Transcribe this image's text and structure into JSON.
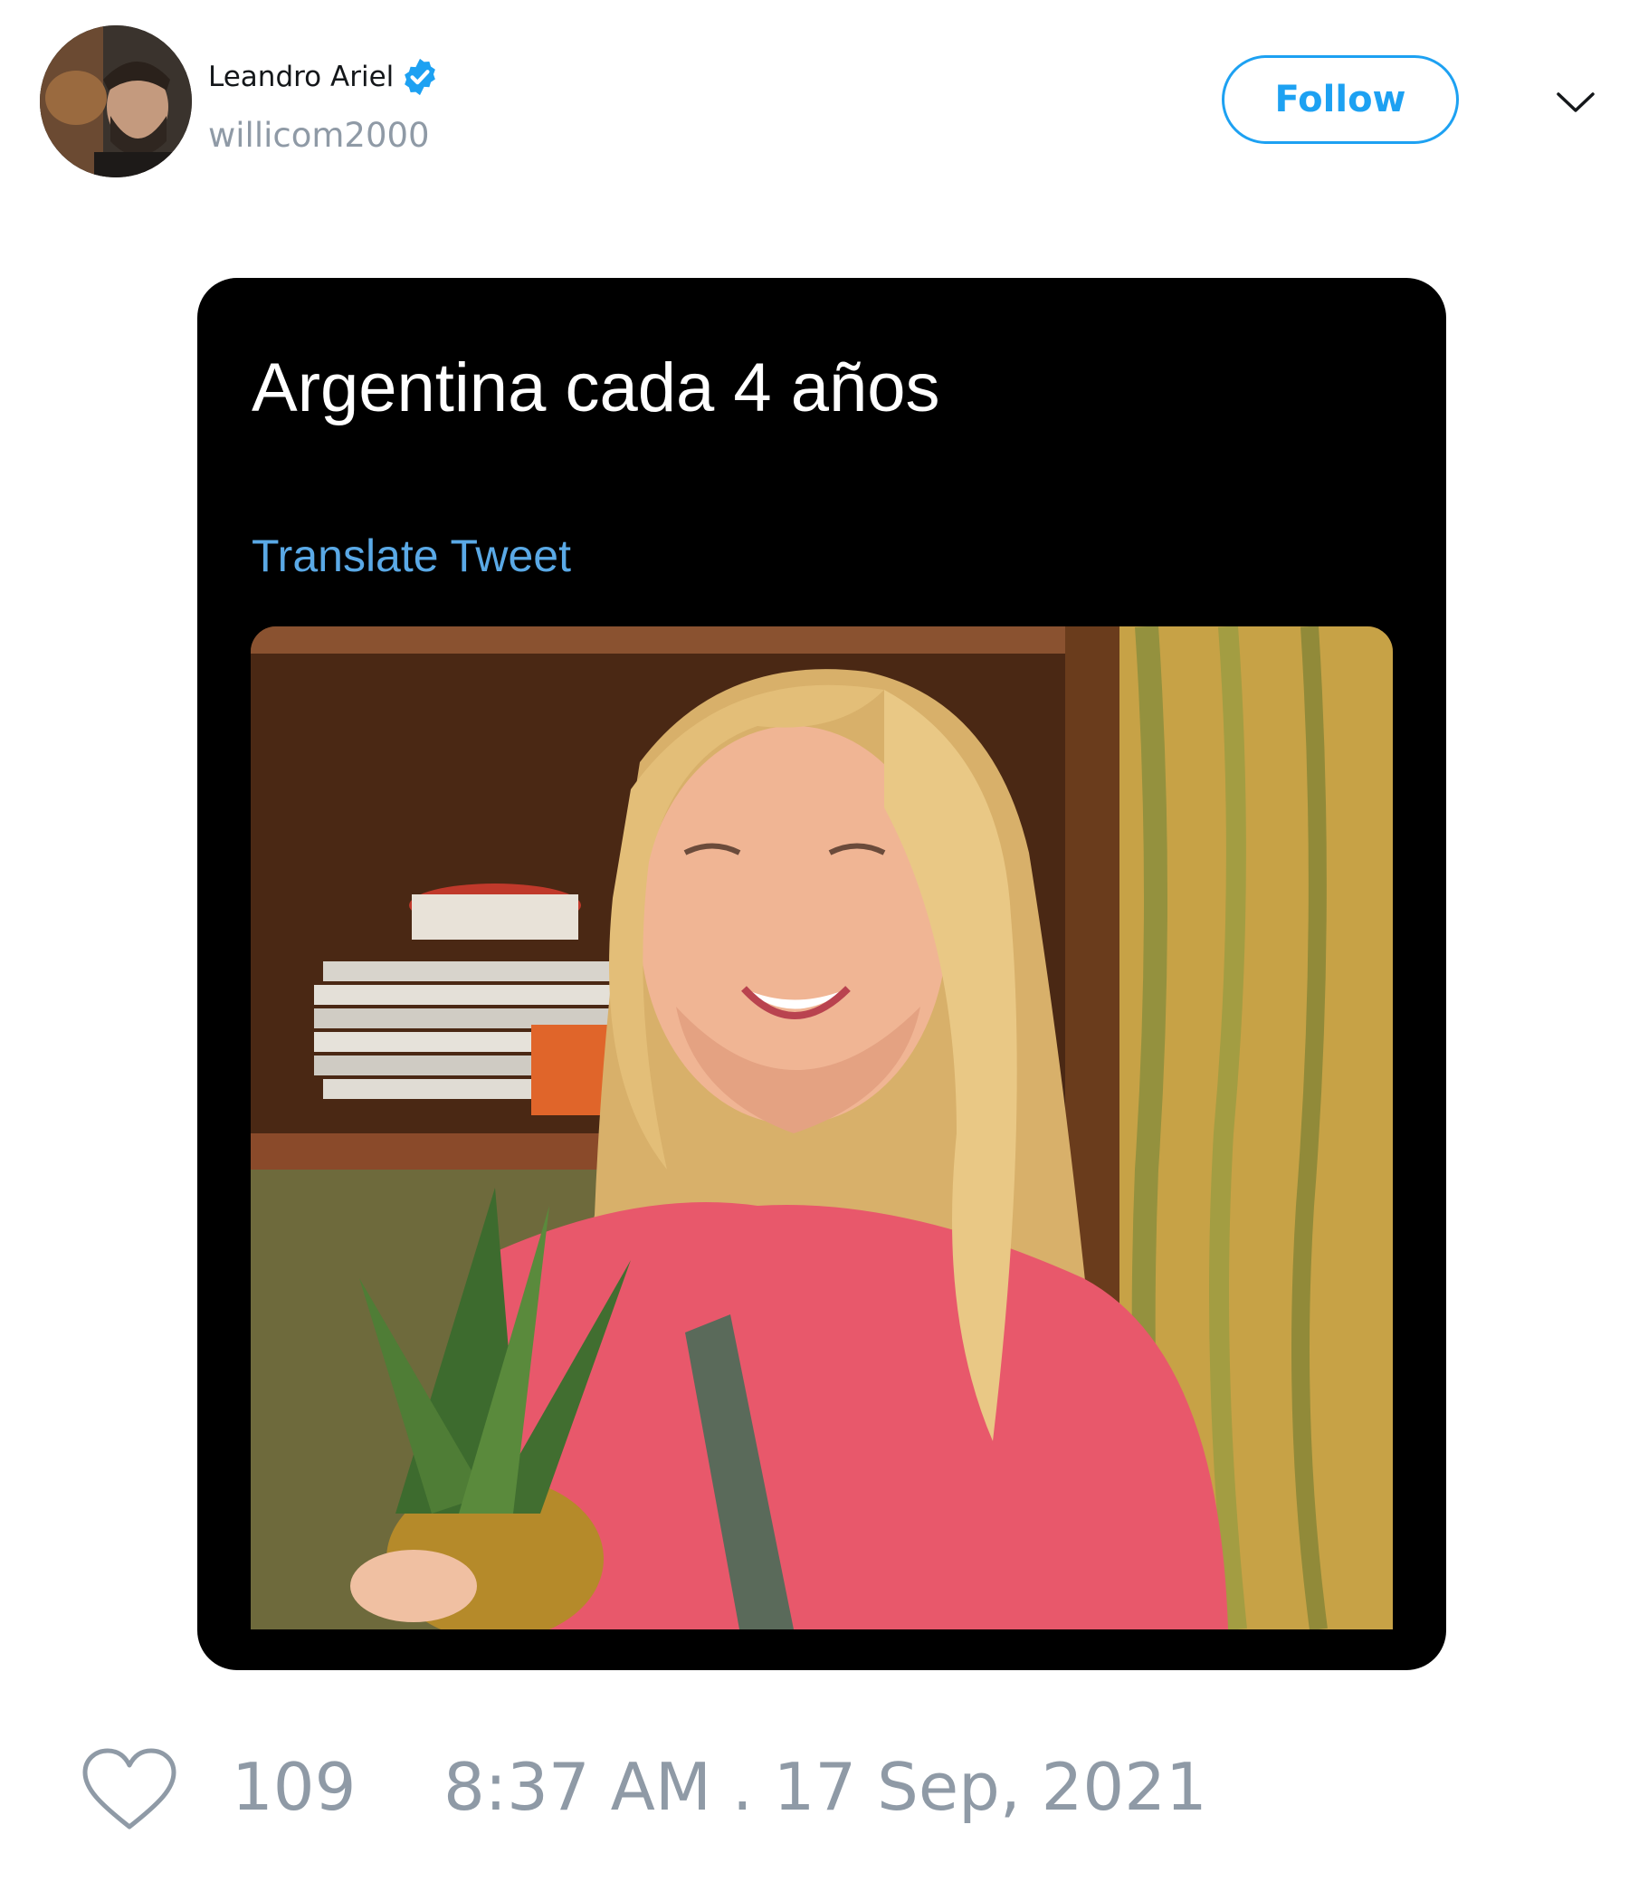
{
  "author": {
    "display_name": "Leandro Ariel",
    "handle": "willicom2000",
    "verified": true
  },
  "actions": {
    "follow_label": "Follow"
  },
  "tweet_media": {
    "embedded_text": "Argentina cada 4 años",
    "translate_label": "Translate Tweet"
  },
  "footer": {
    "like_count": "109",
    "timestamp": "8:37 AM . 17 Sep, 2021"
  },
  "colors": {
    "accent": "#1da1f2",
    "muted_text": "#8f9aa6",
    "card_background": "#000000"
  },
  "icons": [
    "verified-badge-icon",
    "chevron-down-icon",
    "heart-icon"
  ]
}
